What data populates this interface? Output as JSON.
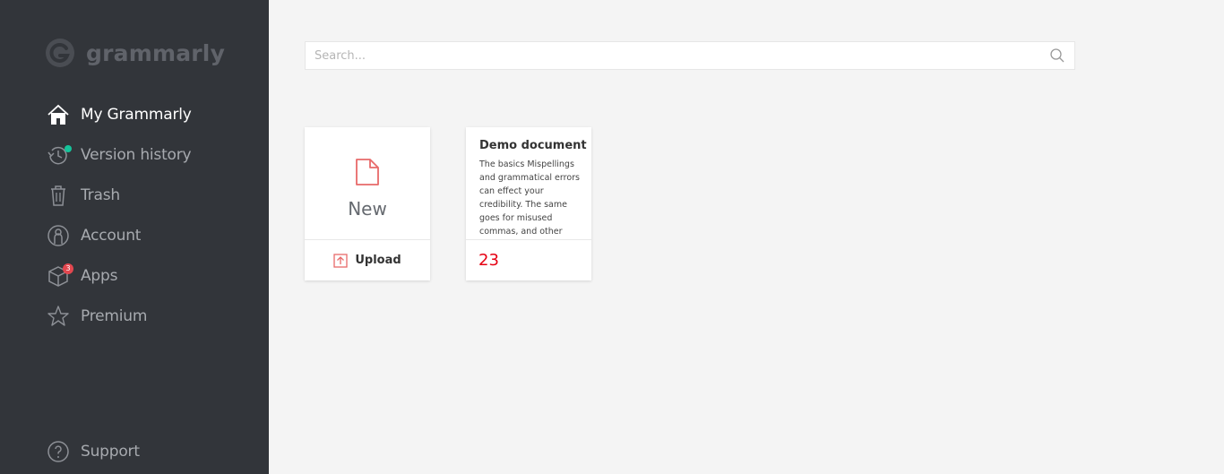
{
  "brand": {
    "name": "grammarly"
  },
  "sidebar": {
    "items": [
      {
        "label": "My Grammarly",
        "icon": "home-icon",
        "active": true
      },
      {
        "label": "Version history",
        "icon": "history-icon",
        "has_dot": true
      },
      {
        "label": "Trash",
        "icon": "trash-icon"
      },
      {
        "label": "Account",
        "icon": "account-icon"
      },
      {
        "label": "Apps",
        "icon": "apps-icon",
        "badge": "3"
      },
      {
        "label": "Premium",
        "icon": "star-icon"
      }
    ],
    "support": {
      "label": "Support",
      "icon": "help-icon"
    }
  },
  "search": {
    "placeholder": "Search...",
    "value": ""
  },
  "cards": {
    "new": {
      "label": "New",
      "upload_label": "Upload"
    },
    "demo": {
      "title": "Demo document",
      "excerpt": "The basics Mispellings and grammatical errors can effect your credibility. The same goes for misused commas, and other",
      "score": "23"
    }
  },
  "colors": {
    "sidebar_bg": "#32353a",
    "page_bg": "#f4f4f4",
    "accent_red": "#e60012",
    "teal": "#15c39a",
    "icon_red": "#e86a6a"
  }
}
